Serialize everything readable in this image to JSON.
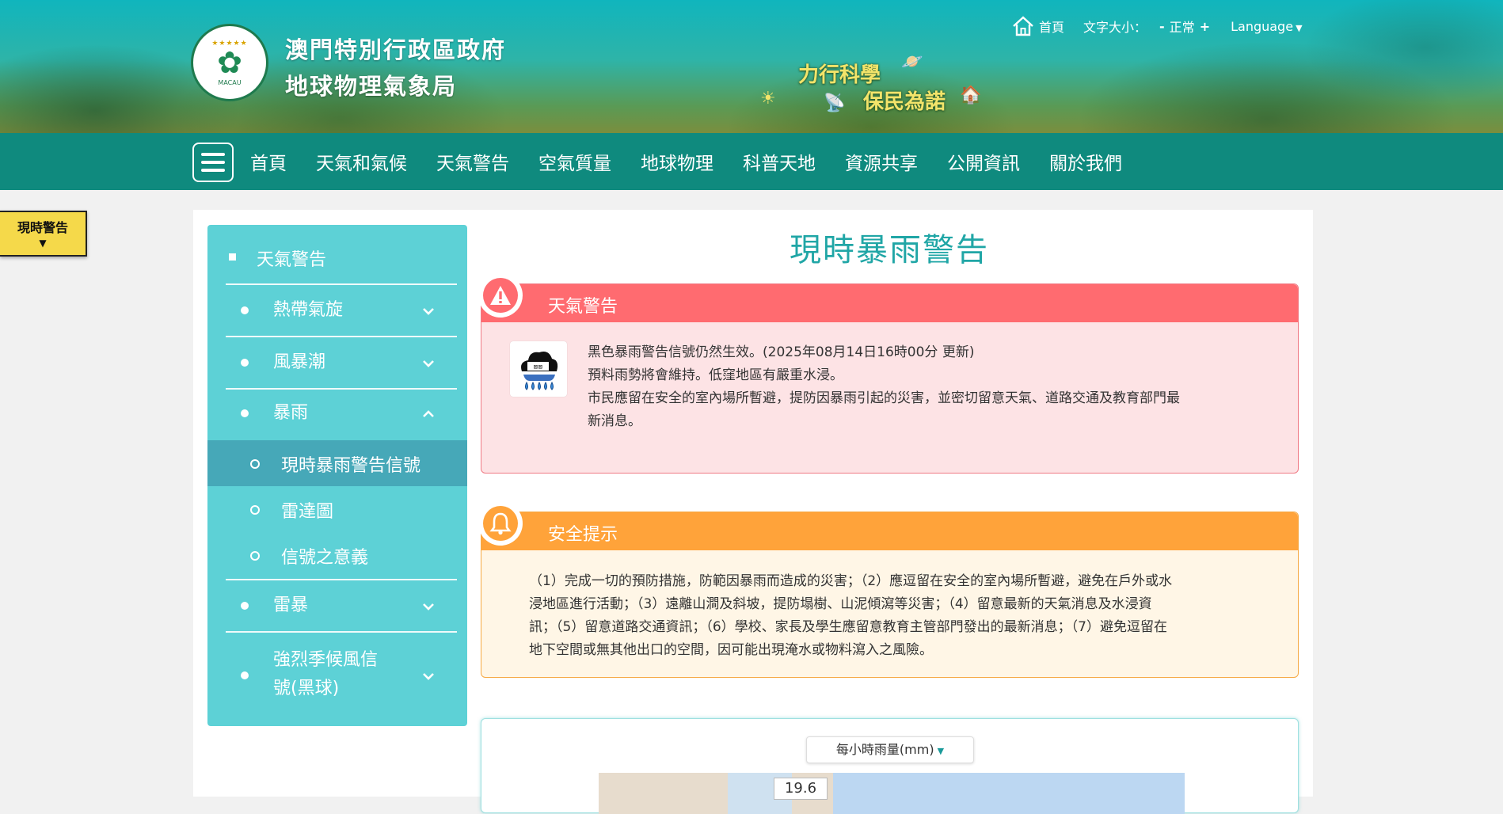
{
  "header": {
    "org_line1": "澳門特別行政區政府",
    "org_line2": "地球物理氣象局",
    "emblem_text": "MACAU",
    "slogan_line1": "力行科學",
    "slogan_line2": "保民為諾",
    "home_label": "首頁",
    "font_size_label": "文字大小：",
    "font_decrease": "-",
    "font_normal": "正常",
    "font_increase": "+",
    "language_label": "Language"
  },
  "nav": {
    "items": [
      "首頁",
      "天氣和氣候",
      "天氣警告",
      "空氣質量",
      "地球物理",
      "科普天地",
      "資源共享",
      "公開資訊",
      "關於我們"
    ]
  },
  "alert_tab": {
    "label": "現時警告"
  },
  "sidebar": {
    "heading": "天氣警告",
    "items": [
      {
        "label": "熱帶氣旋",
        "expanded": false
      },
      {
        "label": "風暴潮",
        "expanded": false
      },
      {
        "label": "暴雨",
        "expanded": true
      },
      {
        "label": "雷暴",
        "expanded": false
      },
      {
        "label_line1": "強烈季候風信",
        "label_line2": "號(黑球)",
        "expanded": false
      }
    ],
    "sub_items": [
      {
        "label": "現時暴雨警告信號",
        "active": true
      },
      {
        "label": "雷達圖",
        "active": false
      },
      {
        "label": "信號之意義",
        "active": false
      }
    ]
  },
  "main": {
    "page_title": "現時暴雨警告",
    "warning_panel": {
      "title": "天氣警告",
      "line1": "黑色暴雨警告信號仍然生效。(2025年08月14日16時00分 更新)",
      "line2": "預料雨勢將會維持。低窪地區有嚴重水浸。",
      "line3": "市民應留在安全的室內場所暫避，提防因暴雨引起的災害，並密切留意天氣、道路交通及教育部門最",
      "line4": "新消息。"
    },
    "safety_panel": {
      "title": "安全提示",
      "line1": "（1）完成一切的預防措施，防範因暴雨而造成的災害；（2）應逗留在安全的室內場所暫避，避免在戶外或水",
      "line2": "浸地區進行活動；（3）遠離山澗及斜坡，提防塌樹、山泥傾瀉等災害；（4）留意最新的天氣消息及水浸資",
      "line3": "訊；（5）留意道路交通資訊；（6）學校、家長及學生應留意教育主管部門發出的最新消息；（7）避免逗留在",
      "line4": "地下空間或無其他出口的空間，因可能出現淹水或物料瀉入之風險。"
    },
    "map_panel": {
      "select_value": "每小時雨量(mm)",
      "map_label": "19.6"
    }
  },
  "colors": {
    "nav_bg": "#0f8a7e",
    "sidebar_bg": "#5dd1d6",
    "title_teal": "#20a6a6",
    "warning_red": "#ff6b70",
    "safety_orange": "#ffa33a",
    "alert_yellow": "#f5d94a"
  }
}
